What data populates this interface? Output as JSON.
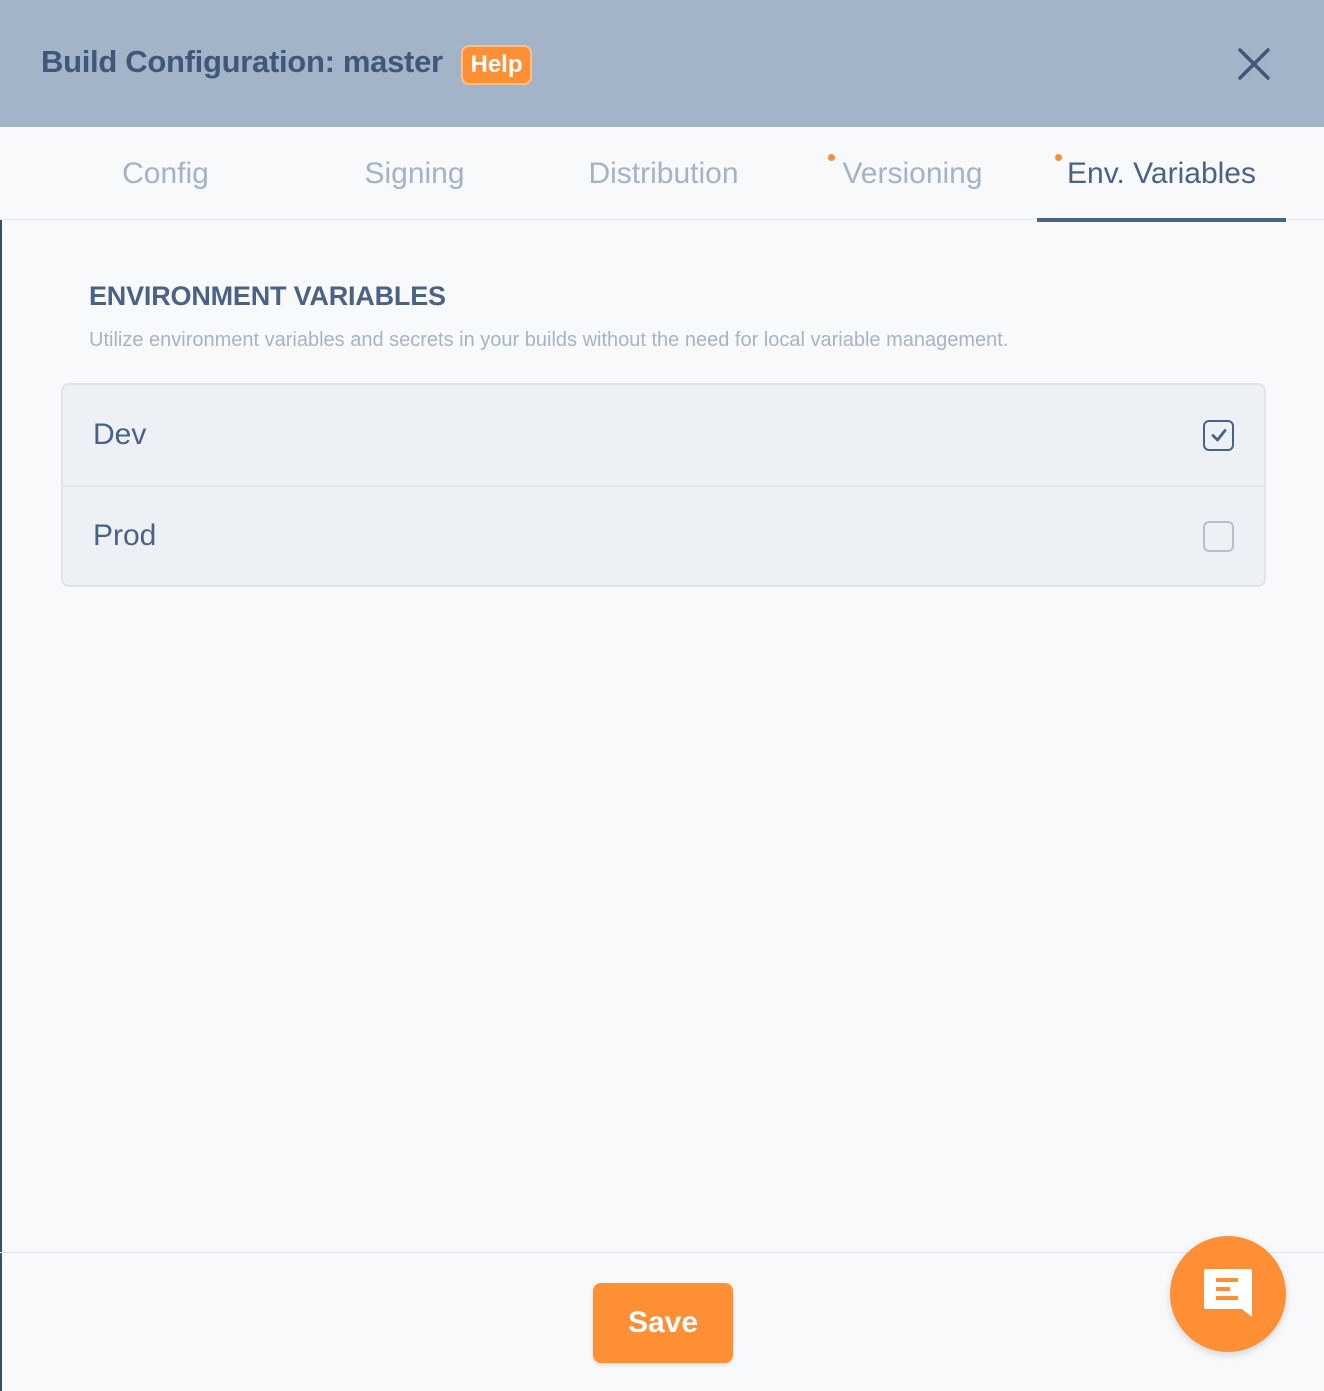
{
  "header": {
    "title": "Build Configuration: master",
    "help_label": "Help",
    "close_icon": "close-icon"
  },
  "tabs": [
    {
      "label": "Config",
      "active": false,
      "has_dot": false
    },
    {
      "label": "Signing",
      "active": false,
      "has_dot": false
    },
    {
      "label": "Distribution",
      "active": false,
      "has_dot": false
    },
    {
      "label": "Versioning",
      "active": false,
      "has_dot": true
    },
    {
      "label": "Env. Variables",
      "active": true,
      "has_dot": true
    }
  ],
  "section": {
    "title": "ENVIRONMENT VARIABLES",
    "description": "Utilize environment variables and secrets in your builds without the need for local variable management."
  },
  "environments": [
    {
      "label": "Dev",
      "checked": true
    },
    {
      "label": "Prod",
      "checked": false
    }
  ],
  "footer": {
    "save_label": "Save"
  },
  "chat": {
    "icon": "chat-icon"
  },
  "colors": {
    "accent": "#ff8f35",
    "header_bg": "#a3b3c8",
    "primary_text": "#4a6385",
    "muted_text": "#a4b3c6",
    "panel_bg": "#f7f9fb"
  }
}
